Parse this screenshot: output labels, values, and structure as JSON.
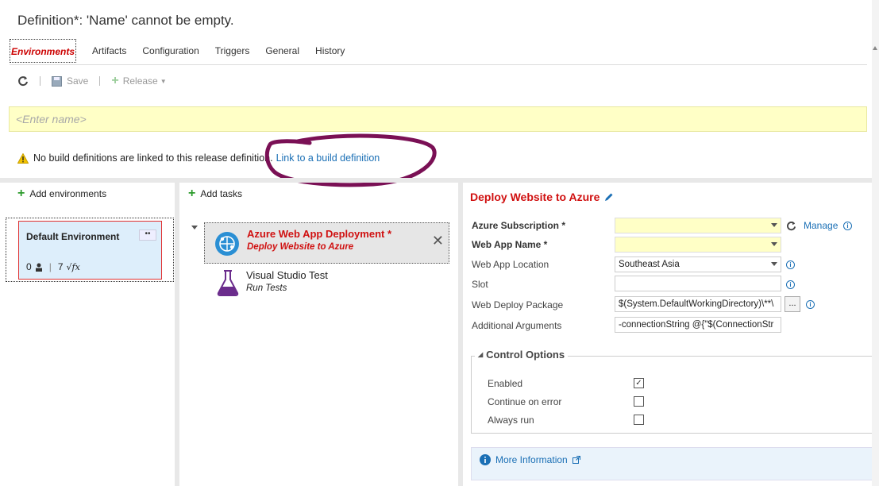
{
  "header": {
    "title": "Definition*: 'Name' cannot be empty."
  },
  "tabs": [
    {
      "label": "Environments",
      "active": true
    },
    {
      "label": "Artifacts"
    },
    {
      "label": "Configuration"
    },
    {
      "label": "Triggers"
    },
    {
      "label": "General"
    },
    {
      "label": "History"
    }
  ],
  "toolbar": {
    "refresh_icon": "refresh-icon",
    "save_label": "Save",
    "release_label": "Release"
  },
  "name_input": {
    "placeholder": "<Enter name>",
    "value": ""
  },
  "warning": {
    "text": "No build definitions are linked to this release definition.",
    "link": "Link to a build definition"
  },
  "environments": {
    "add_label": "Add environments",
    "items": [
      {
        "name": "Default Environment",
        "approvers": "0",
        "variables": "7"
      }
    ]
  },
  "tasks": {
    "add_label": "Add tasks",
    "items": [
      {
        "title": "Azure Web App Deployment *",
        "subtitle": "Deploy Website to Azure",
        "selected": true
      },
      {
        "title": "Visual Studio Test",
        "subtitle": "Run Tests",
        "selected": false
      }
    ]
  },
  "details": {
    "title": "Deploy Website to Azure",
    "fields": [
      {
        "label": "Azure Subscription *",
        "value": "",
        "required": true
      },
      {
        "label": "Web App Name *",
        "value": "",
        "required": true
      },
      {
        "label": "Web App Location",
        "value": "Southeast Asia"
      },
      {
        "label": "Slot",
        "value": ""
      },
      {
        "label": "Web Deploy Package",
        "value": "$(System.DefaultWorkingDirectory)\\**\\"
      },
      {
        "label": "Additional Arguments",
        "value": "-connectionString @{\"$(ConnectionStr"
      }
    ],
    "manage_label": "Manage",
    "browse_label": "...",
    "control_options": {
      "legend": "Control Options",
      "rows": [
        {
          "label": "Enabled",
          "checked": true
        },
        {
          "label": "Continue on error",
          "checked": false
        },
        {
          "label": "Always run",
          "checked": false
        }
      ]
    },
    "more_info": "More Information"
  },
  "colors": {
    "accent_red": "#d01010",
    "link_blue": "#1a6fb5",
    "highlight_yellow": "#ffffc6",
    "add_green": "#2b9b2b"
  }
}
